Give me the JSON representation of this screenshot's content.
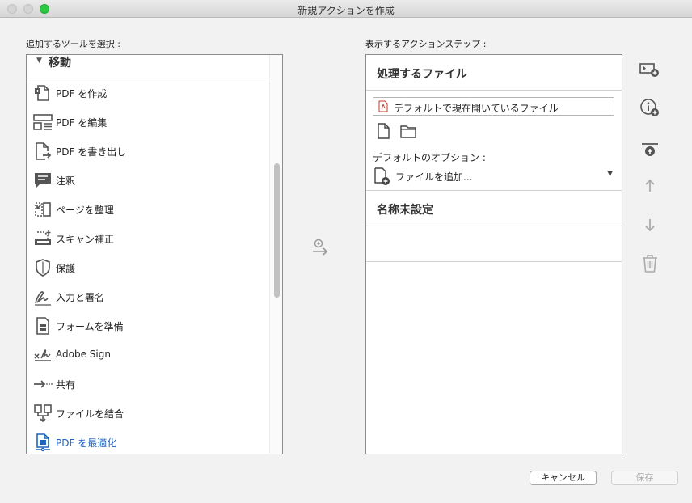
{
  "window": {
    "title": "新規アクションを作成"
  },
  "left": {
    "label": "追加するツールを選択 :",
    "group_header": "移動",
    "tools": [
      {
        "label": "PDF を作成",
        "icon": "create-pdf-icon"
      },
      {
        "label": "PDF を編集",
        "icon": "edit-pdf-icon"
      },
      {
        "label": "PDF を書き出し",
        "icon": "export-pdf-icon"
      },
      {
        "label": "注釈",
        "icon": "comment-icon"
      },
      {
        "label": "ページを整理",
        "icon": "organize-pages-icon"
      },
      {
        "label": "スキャン補正",
        "icon": "scan-enhance-icon"
      },
      {
        "label": "保護",
        "icon": "protect-shield-icon"
      },
      {
        "label": "入力と署名",
        "icon": "fill-sign-icon"
      },
      {
        "label": "フォームを準備",
        "icon": "prepare-form-icon"
      },
      {
        "label": "Adobe Sign",
        "icon": "adobe-sign-icon"
      },
      {
        "label": "共有",
        "icon": "share-icon"
      },
      {
        "label": "ファイルを結合",
        "icon": "combine-files-icon"
      },
      {
        "label": "PDF を最適化",
        "icon": "optimize-pdf-icon",
        "active": true
      }
    ]
  },
  "right": {
    "label": "表示するアクションステップ :",
    "files_heading": "処理するファイル",
    "file_value": "デフォルトで現在開いているファイル",
    "default_options_label": "デフォルトのオプション :",
    "default_option_value": "ファイルを追加...",
    "untitled_heading": "名称未設定"
  },
  "buttons": {
    "cancel": "キャンセル",
    "save": "保存"
  },
  "colors": {
    "active_link": "#1f63c0",
    "maximize": "#2bc840"
  }
}
